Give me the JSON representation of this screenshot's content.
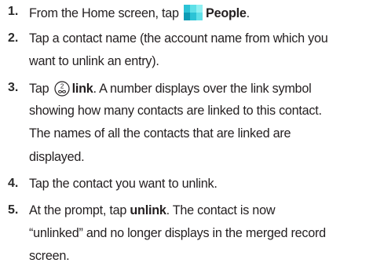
{
  "steps": [
    {
      "number": "1.",
      "lines": [
        {
          "before": "From the Home screen, tap ",
          "bold": "People",
          "after": "."
        }
      ]
    },
    {
      "number": "2.",
      "lines": [
        "Tap a contact name (the account name from which you",
        "want to unlink an entry)."
      ]
    },
    {
      "number": "3.",
      "lines": [
        {
          "before": "Tap ",
          "link_digit": "2",
          "bold": "link",
          "after": ". A number displays over the link symbol"
        },
        "showing how many contacts are linked to this contact.",
        "The names of all the contacts that are linked are",
        "displayed."
      ]
    },
    {
      "number": "4.",
      "lines": [
        "Tap the contact you want to unlink."
      ]
    },
    {
      "number": "5.",
      "lines": [
        {
          "before": "At the prompt, tap ",
          "bold": "unlink",
          "after": ". The contact is now"
        },
        "“unlinked” and no longer displays in the merged record",
        "screen."
      ]
    }
  ],
  "icons": {
    "people": "people-app-icon",
    "link": "link-icon"
  },
  "colors": {
    "text": "#231f20",
    "people_icon_light": "#5fe0e8",
    "people_icon_mid": "#2cc3d6",
    "people_icon_dark": "#0d9bb5"
  }
}
